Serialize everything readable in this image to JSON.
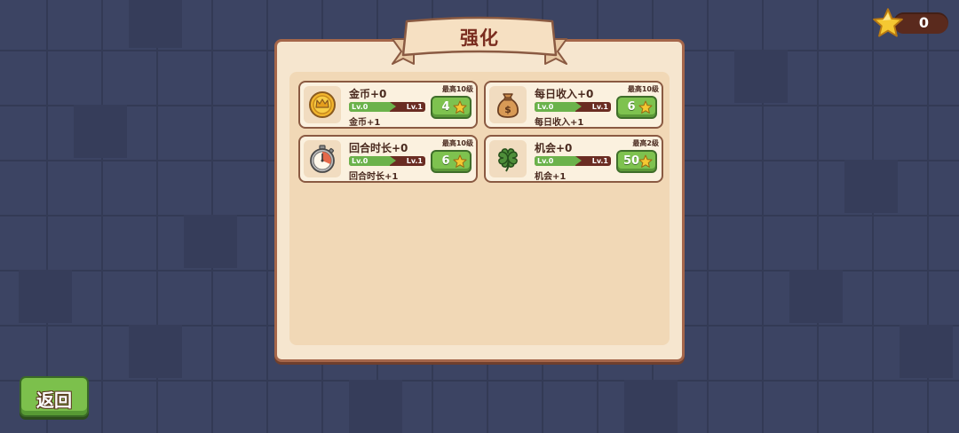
{
  "header": {
    "star_count": "0"
  },
  "panel": {
    "title": "强化"
  },
  "upgrades": [
    {
      "icon": "gold-coin-icon",
      "name": "金币+0",
      "max": "最高10级",
      "level_from": "Lv.0",
      "level_to": "Lv.1",
      "desc": "金币+1",
      "price": "4"
    },
    {
      "icon": "money-bag-icon",
      "name": "每日收入+0",
      "max": "最高10级",
      "level_from": "Lv.0",
      "level_to": "Lv.1",
      "desc": "每日收入+1",
      "price": "6"
    },
    {
      "icon": "stopwatch-icon",
      "name": "回合时长+0",
      "max": "最高10级",
      "level_from": "Lv.0",
      "level_to": "Lv.1",
      "desc": "回合时长+1",
      "price": "6"
    },
    {
      "icon": "four-leaf-clover-icon",
      "name": "机会+0",
      "max": "最高2级",
      "level_from": "Lv.0",
      "level_to": "Lv.1",
      "desc": "机会+1",
      "price": "50"
    }
  ],
  "footer": {
    "back_label": "返回"
  },
  "colors": {
    "background": "#3c4463",
    "panel": "#f6e6cf",
    "button_green": "#7ec24f",
    "title_text": "#7a2d1f",
    "star": "#f5c832"
  }
}
